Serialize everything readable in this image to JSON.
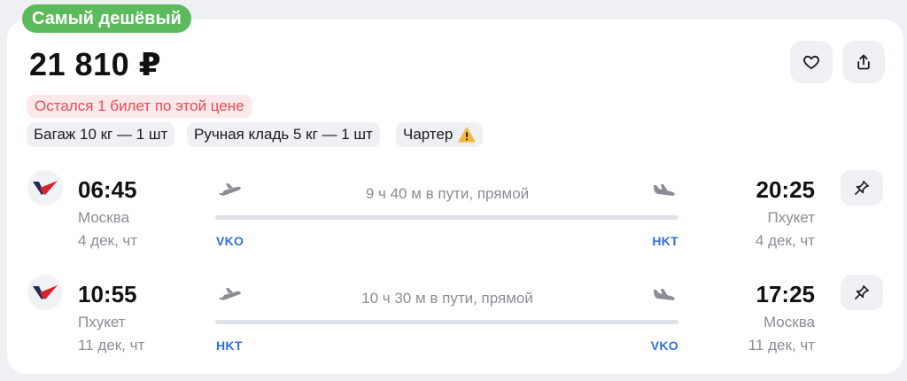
{
  "badge": {
    "label": "Самый дешёвый"
  },
  "price": {
    "amount": "21 810 ₽"
  },
  "actions": {
    "favorite_icon": "heart-icon",
    "share_icon": "share-icon"
  },
  "alert": {
    "text": "Остался 1 билет по этой цене"
  },
  "tags": [
    {
      "label": "Багаж 10 кг — 1 шт"
    },
    {
      "label": "Ручная кладь 5 кг — 1 шт"
    },
    {
      "label": "Чартер",
      "icon": "warning-icon"
    }
  ],
  "colors": {
    "badge_bg": "#5bbb5c",
    "alert_bg": "#fde9ea",
    "alert_text": "#e84a52",
    "airport_code": "#2f6fe0",
    "route_line": "#dfe2e7",
    "muted_text": "#8a8d93",
    "chip_bg": "#eef0f3"
  },
  "segments": [
    {
      "dep_time": "06:45",
      "dep_city": "Москва",
      "dep_date": "4 дек, чт",
      "duration": "9 ч 40 м в пути, прямой",
      "dep_code": "VKO",
      "arr_code": "HKT",
      "arr_time": "20:25",
      "arr_city": "Пхукет",
      "arr_date": "4 дек, чт"
    },
    {
      "dep_time": "10:55",
      "dep_city": "Пхукет",
      "dep_date": "11 дек, чт",
      "duration": "10 ч 30 м в пути, прямой",
      "dep_code": "HKT",
      "arr_code": "VKO",
      "arr_time": "17:25",
      "arr_city": "Москва",
      "arr_date": "11 дек, чт"
    }
  ]
}
